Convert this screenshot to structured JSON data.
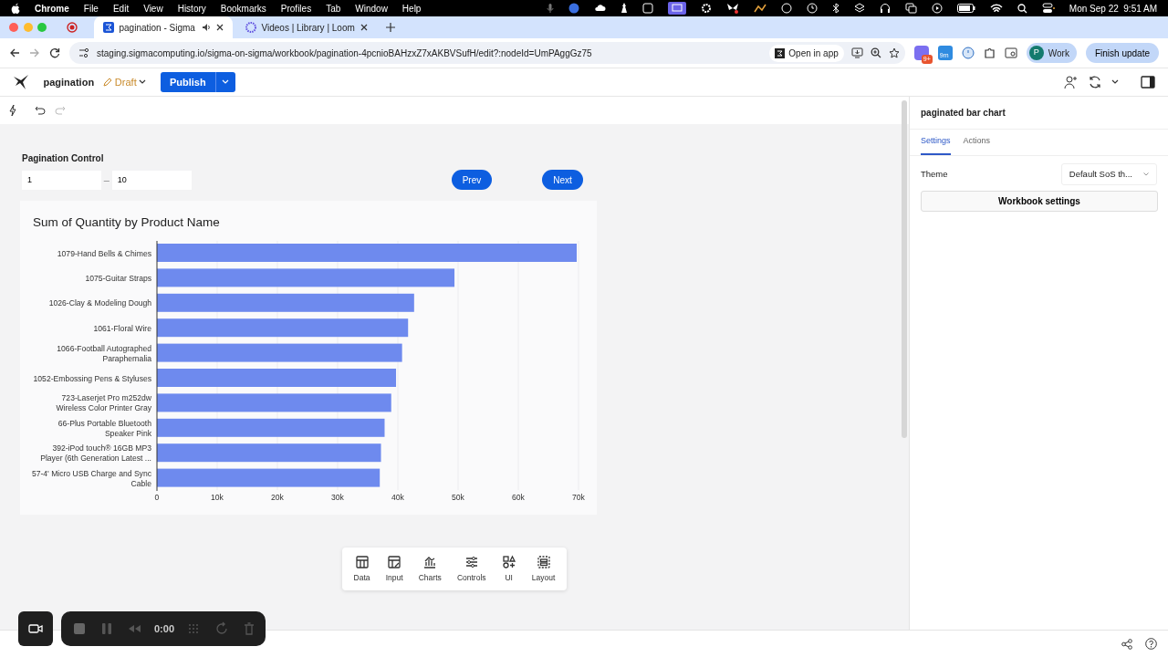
{
  "menu_bar": {
    "app": "Chrome",
    "menus": [
      "File",
      "Edit",
      "View",
      "History",
      "Bookmarks",
      "Profiles",
      "Tab",
      "Window",
      "Help"
    ],
    "date": "Mon Sep 22",
    "time": "9:51 AM"
  },
  "browser": {
    "tabs": [
      {
        "title": "pagination - Sigma",
        "selected": true
      },
      {
        "title": "Videos | Library | Loom",
        "selected": false
      }
    ],
    "url": "staging.sigmacomputing.io/sigma-on-sigma/workbook/pagination-4pcnioBAHzxZ7xAKBVSufH/edit?:nodeId=UmPAggGz75",
    "open_in_app": "Open in app",
    "extension_badges": [
      "9+",
      "9m"
    ],
    "profile": {
      "initial": "P",
      "label": "Work"
    },
    "update_button": "Finish update"
  },
  "app_header": {
    "workbook": "pagination",
    "status": "Draft",
    "publish": "Publish"
  },
  "canvas": {
    "control": {
      "label": "Pagination Control",
      "from": "1",
      "separator": "–",
      "to": "10"
    },
    "buttons": [
      "Prev",
      "Next"
    ],
    "chart_data": {
      "type": "bar",
      "orientation": "horizontal",
      "title": "Sum of Quantity by Product Name",
      "categories": [
        "1079-Hand Bells & Chimes",
        "1075-Guitar Straps",
        "1026-Clay & Modeling Dough",
        "1061-Floral Wire",
        "1066-Football Autographed\nParaphernalia",
        "1052-Embossing Pens & Styluses",
        "723-Laserjet Pro m252dw\nWireless Color Printer Gray",
        "66-Plus Portable Bluetooth\nSpeaker Pink",
        "392-iPod touch® 16GB MP3\nPlayer (6th Generation Latest ...",
        "57-4' Micro USB Charge and Sync\nCable"
      ],
      "values": [
        69700,
        49400,
        42700,
        41700,
        40700,
        39700,
        38900,
        37800,
        37200,
        37000
      ],
      "xlim": [
        0,
        70000
      ],
      "grid": true,
      "xticks": [
        {
          "value": 0,
          "label": "0"
        },
        {
          "value": 10000,
          "label": "10k"
        },
        {
          "value": 20000,
          "label": "20k"
        },
        {
          "value": 30000,
          "label": "30k"
        },
        {
          "value": 40000,
          "label": "40k"
        },
        {
          "value": 50000,
          "label": "50k"
        },
        {
          "value": 60000,
          "label": "60k"
        },
        {
          "value": 70000,
          "label": "70k"
        }
      ]
    }
  },
  "add_toolbar": [
    {
      "label": "Data",
      "kind": "table"
    },
    {
      "label": "Input",
      "kind": "input"
    },
    {
      "label": "Charts",
      "kind": "chart"
    },
    {
      "label": "Controls",
      "kind": "sliders"
    },
    {
      "label": "UI",
      "kind": "shapes"
    },
    {
      "label": "Layout",
      "kind": "layout"
    }
  ],
  "recorder": {
    "time": "0:00"
  },
  "panel": {
    "title": "paginated bar chart",
    "tabs": [
      {
        "label": "Settings",
        "selected": true
      },
      {
        "label": "Actions",
        "selected": false
      }
    ],
    "theme_label": "Theme",
    "theme_value": "Default SoS th...",
    "workbook_button": "Workbook settings"
  }
}
